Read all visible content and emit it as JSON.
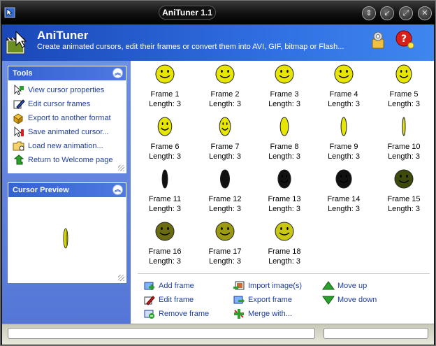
{
  "window": {
    "title": "AniTuner 1.1"
  },
  "header": {
    "title": "AniTuner",
    "subtitle": "Create animated cursors, edit their frames or convert them into AVI, GIF, bitmap or Flash..."
  },
  "tools_panel": {
    "title": "Tools",
    "items": [
      {
        "label": "View cursor properties",
        "icon": "cursor-properties-icon"
      },
      {
        "label": "Edit cursor frames",
        "icon": "edit-frames-icon"
      },
      {
        "label": "Export to another format",
        "icon": "export-format-icon"
      },
      {
        "label": "Save animated cursor...",
        "icon": "save-cursor-icon"
      },
      {
        "label": "Load new animation...",
        "icon": "load-animation-icon"
      },
      {
        "label": "Return to Welcome page",
        "icon": "return-arrow-icon"
      }
    ]
  },
  "preview_panel": {
    "title": "Cursor Preview"
  },
  "frames": [
    {
      "label": "Frame 1",
      "length": "Length: 3",
      "squash": 1.0,
      "color": "#e6e600"
    },
    {
      "label": "Frame 2",
      "length": "Length: 3",
      "squash": 1.0,
      "color": "#e6e600"
    },
    {
      "label": "Frame 3",
      "length": "Length: 3",
      "squash": 1.0,
      "color": "#e6e600"
    },
    {
      "label": "Frame 4",
      "length": "Length: 3",
      "squash": 1.0,
      "color": "#e6e600"
    },
    {
      "label": "Frame 5",
      "length": "Length: 3",
      "squash": 0.85,
      "color": "#e6e600"
    },
    {
      "label": "Frame 6",
      "length": "Length: 3",
      "squash": 0.75,
      "color": "#e6e600"
    },
    {
      "label": "Frame 7",
      "length": "Length: 3",
      "squash": 0.6,
      "color": "#e6e600"
    },
    {
      "label": "Frame 8",
      "length": "Length: 3",
      "squash": 0.45,
      "color": "#e6e600"
    },
    {
      "label": "Frame 9",
      "length": "Length: 3",
      "squash": 0.3,
      "color": "#e6e600"
    },
    {
      "label": "Frame 10",
      "length": "Length: 3",
      "squash": 0.15,
      "color": "#e6e600"
    },
    {
      "label": "Frame 11",
      "length": "Length: 3",
      "squash": 0.3,
      "color": "#111111"
    },
    {
      "label": "Frame 12",
      "length": "Length: 3",
      "squash": 0.5,
      "color": "#111111"
    },
    {
      "label": "Frame 13",
      "length": "Length: 3",
      "squash": 0.7,
      "color": "#111111"
    },
    {
      "label": "Frame 14",
      "length": "Length: 3",
      "squash": 0.85,
      "color": "#111111"
    },
    {
      "label": "Frame 15",
      "length": "Length: 3",
      "squash": 1.0,
      "color": "#3c4a0c"
    },
    {
      "label": "Frame 16",
      "length": "Length: 3",
      "squash": 1.0,
      "color": "#6b6b12"
    },
    {
      "label": "Frame 17",
      "length": "Length: 3",
      "squash": 1.0,
      "color": "#9b9b12"
    },
    {
      "label": "Frame 18",
      "length": "Length: 3",
      "squash": 1.0,
      "color": "#c8c812"
    }
  ],
  "actions": [
    {
      "label": "Add frame",
      "icon": "add-frame-icon"
    },
    {
      "label": "Edit frame",
      "icon": "edit-frame-icon"
    },
    {
      "label": "Remove frame",
      "icon": "remove-frame-icon"
    },
    {
      "label": "Import image(s)",
      "icon": "import-image-icon"
    },
    {
      "label": "Export frame",
      "icon": "export-frame-icon"
    },
    {
      "label": "Merge with...",
      "icon": "merge-icon"
    },
    {
      "label": "Move up",
      "icon": "move-up-icon"
    },
    {
      "label": "Move down",
      "icon": "move-down-icon"
    }
  ],
  "colors": {
    "accent": "#2f6ee0",
    "link": "#1f3f9f",
    "smiley": "#e6e600"
  }
}
